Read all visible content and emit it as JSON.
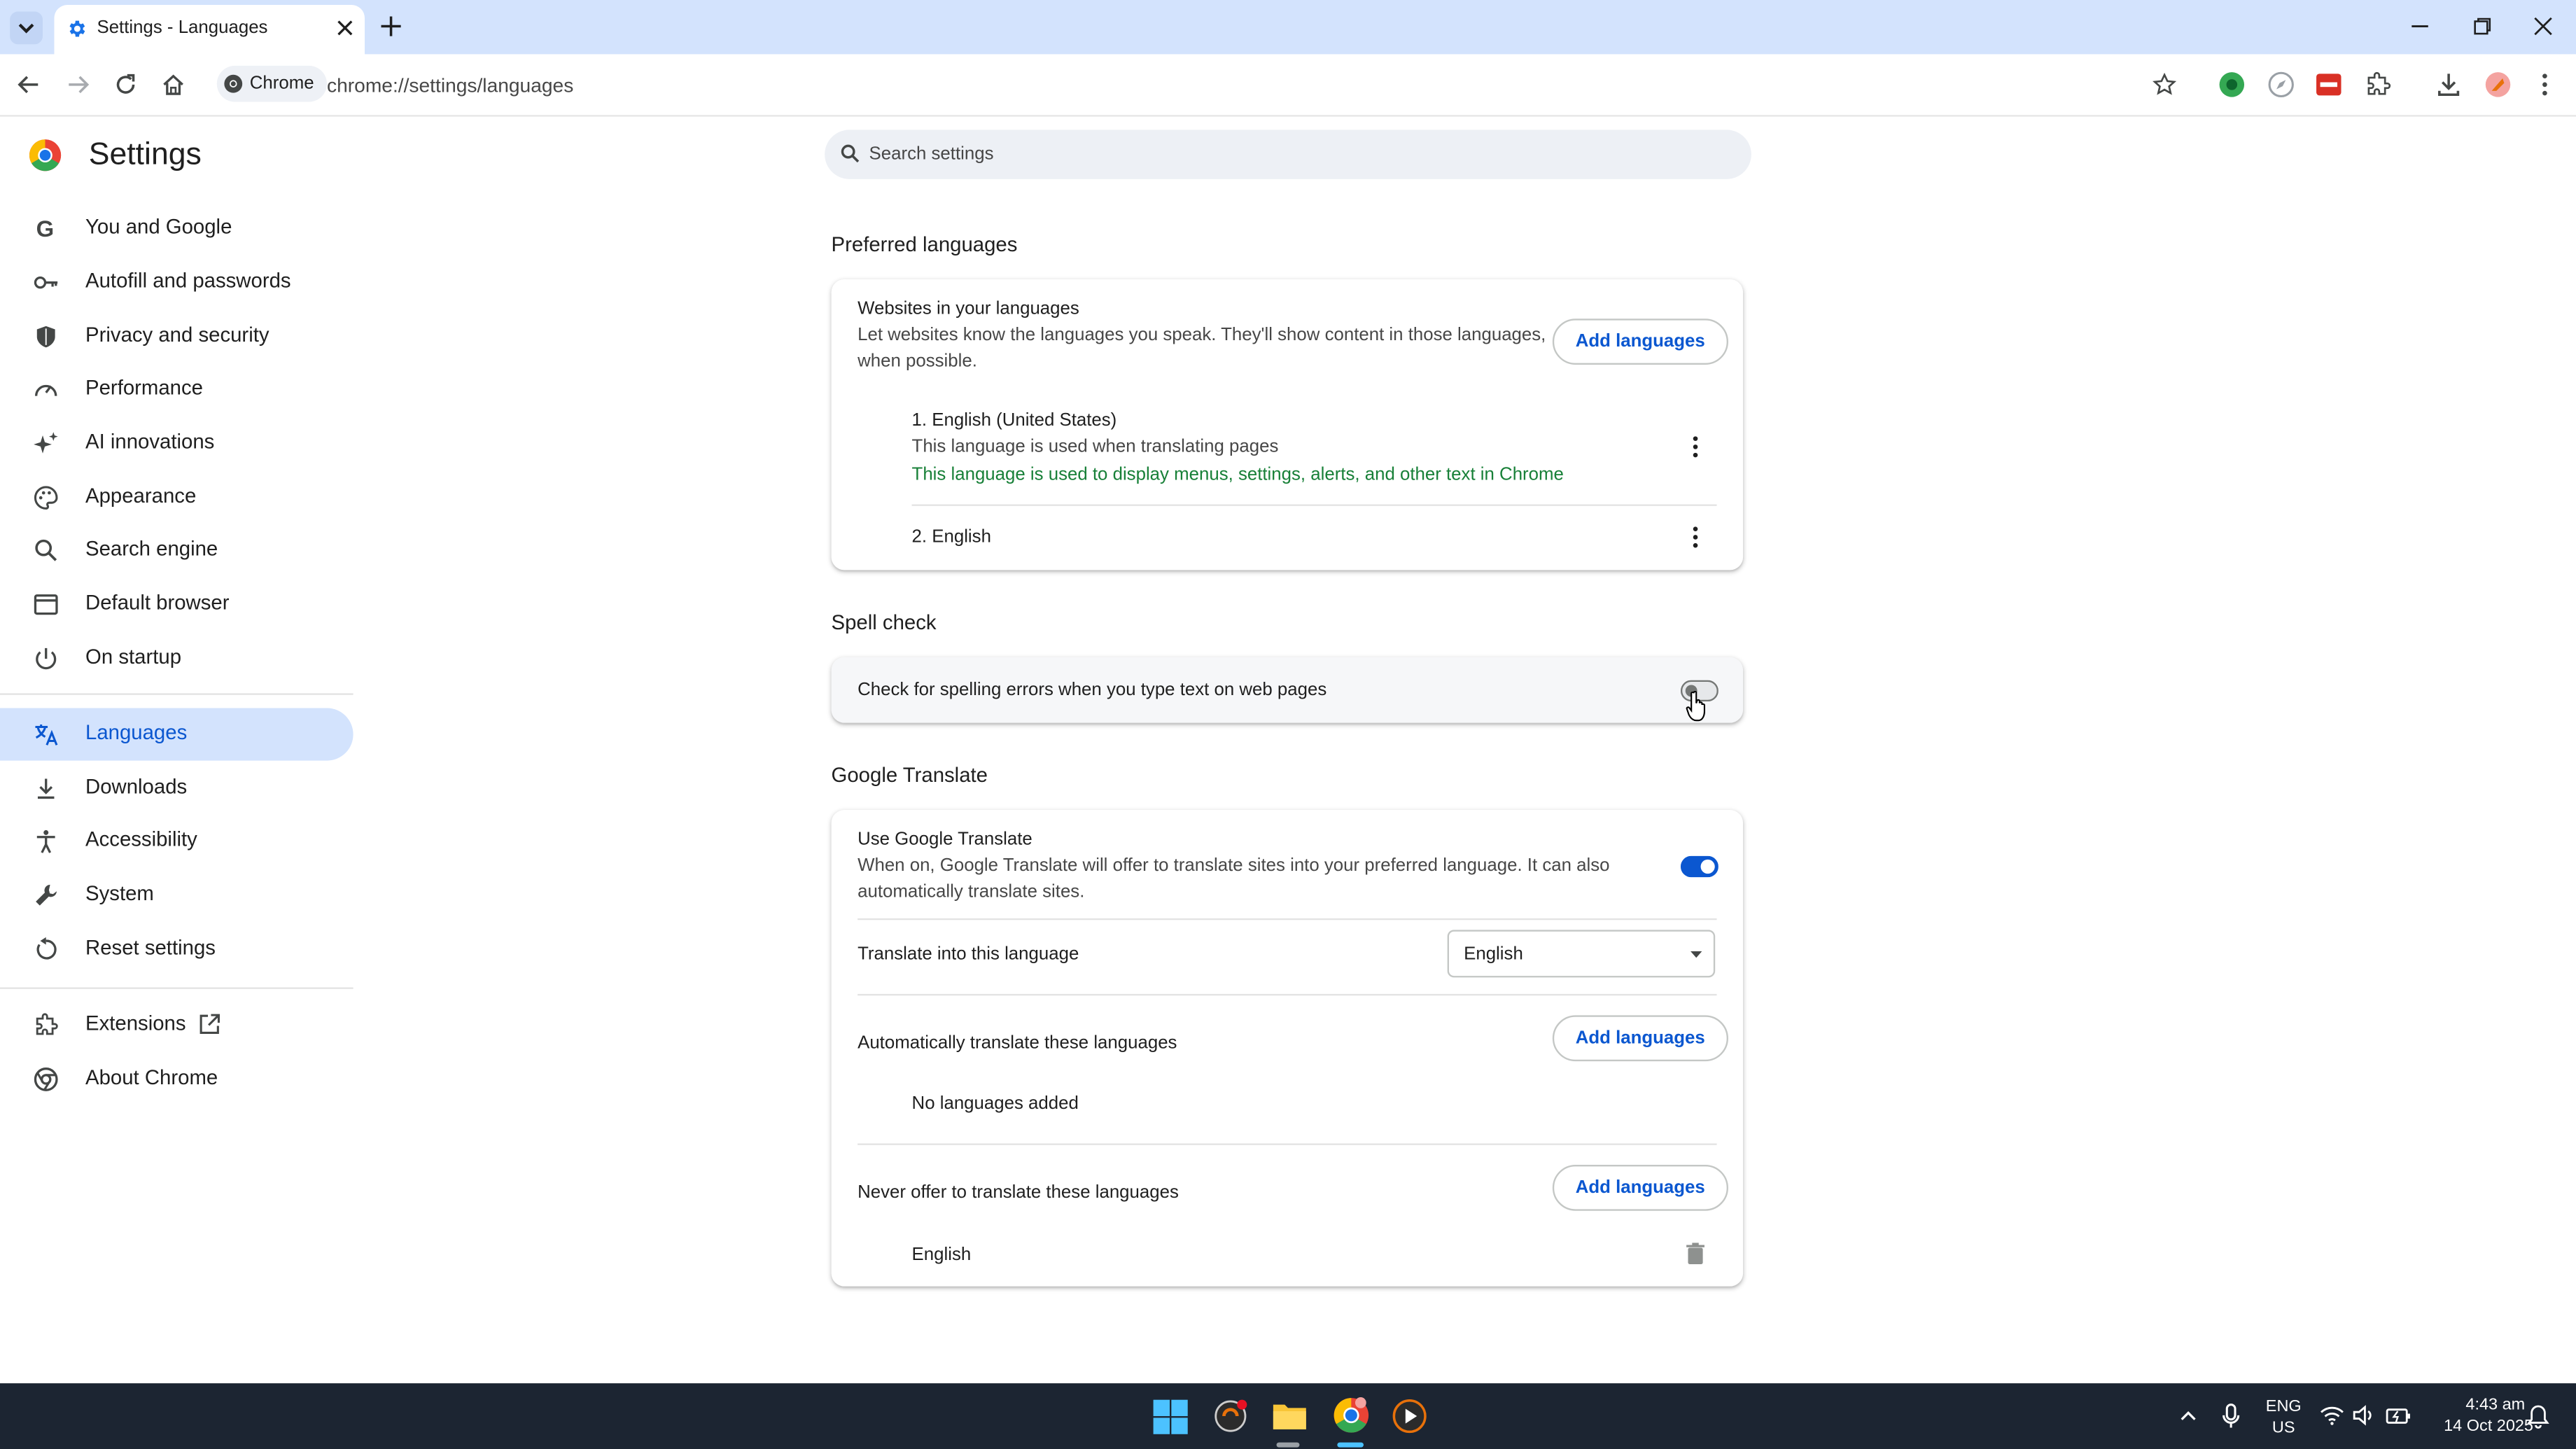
{
  "browser": {
    "tab_title": "Settings - Languages",
    "chip_label": "Chrome",
    "url": "chrome://settings/languages"
  },
  "sidebar": {
    "title": "Settings",
    "items": [
      {
        "label": "You and Google",
        "icon": "google-icon"
      },
      {
        "label": "Autofill and passwords",
        "icon": "key-icon"
      },
      {
        "label": "Privacy and security",
        "icon": "shield-icon"
      },
      {
        "label": "Performance",
        "icon": "speedometer-icon"
      },
      {
        "label": "AI innovations",
        "icon": "sparkle-icon"
      },
      {
        "label": "Appearance",
        "icon": "palette-icon"
      },
      {
        "label": "Search engine",
        "icon": "search-icon"
      },
      {
        "label": "Default browser",
        "icon": "browser-window-icon"
      },
      {
        "label": "On startup",
        "icon": "power-icon"
      },
      {
        "label": "Languages",
        "icon": "translate-icon",
        "active": true
      },
      {
        "label": "Downloads",
        "icon": "download-icon"
      },
      {
        "label": "Accessibility",
        "icon": "accessibility-icon"
      },
      {
        "label": "System",
        "icon": "wrench-icon"
      },
      {
        "label": "Reset settings",
        "icon": "reset-icon"
      },
      {
        "label": "Extensions",
        "icon": "puzzle-icon"
      },
      {
        "label": "About Chrome",
        "icon": "chrome-icon"
      }
    ]
  },
  "search": {
    "placeholder": "Search settings"
  },
  "preferred": {
    "section_title": "Preferred languages",
    "heading": "Websites in your languages",
    "desc_line1": "Let websites know the languages you speak. They'll show content in those languages,",
    "desc_line2": "when possible.",
    "add_button": "Add languages",
    "languages": [
      {
        "name": "1. English (United States)",
        "note": "This language is used when translating pages",
        "ui_note": "This language is used to display menus, settings, alerts, and other text in Chrome"
      },
      {
        "name": "2. English"
      }
    ]
  },
  "spell": {
    "section_title": "Spell check",
    "label": "Check for spelling errors when you type text on web pages",
    "enabled": false
  },
  "translate": {
    "section_title": "Google Translate",
    "heading": "Use Google Translate",
    "desc_line1": "When on, Google Translate will offer to translate sites into your preferred language. It can also",
    "desc_line2": "automatically translate sites.",
    "enabled": true,
    "target_label": "Translate into this language",
    "target_value": "English",
    "auto_label": "Automatically translate these languages",
    "auto_add": "Add languages",
    "auto_empty": "No languages added",
    "never_label": "Never offer to translate these languages",
    "never_add": "Add languages",
    "never_items": [
      "English"
    ]
  },
  "taskbar": {
    "lang_line1": "ENG",
    "lang_line2": "US",
    "time": "4:43 am",
    "date": "14 Oct 2025"
  },
  "colors": {
    "accent": "#0b57d0",
    "green_note": "#188038",
    "titlebar": "#d3e3fd",
    "taskbar": "#1c2532"
  }
}
